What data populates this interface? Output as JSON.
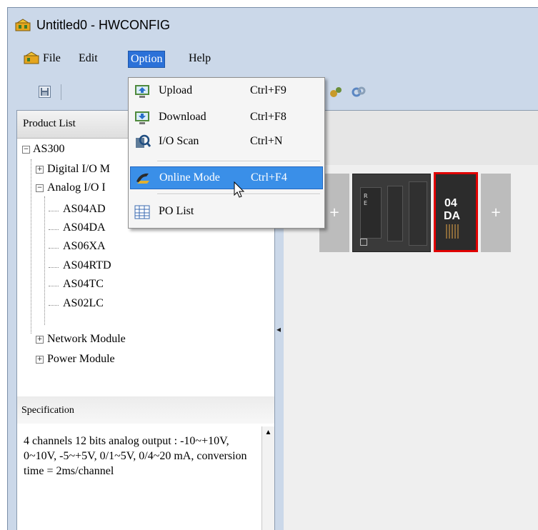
{
  "window": {
    "title": "Untitled0 - HWCONFIG"
  },
  "menubar": {
    "items": [
      {
        "label": "File",
        "accel": "F"
      },
      {
        "label": "Edit",
        "accel": ""
      },
      {
        "label": "Option",
        "accel": "O"
      },
      {
        "label": "Help",
        "accel": "H"
      }
    ]
  },
  "option_menu": {
    "items": [
      {
        "label": "Upload",
        "shortcut": "Ctrl+F9",
        "icon": "upload-icon"
      },
      {
        "label": "Download",
        "shortcut": "Ctrl+F8",
        "icon": "download-icon"
      },
      {
        "label": "I/O Scan",
        "shortcut": "Ctrl+N",
        "icon": "io-scan-icon"
      },
      {
        "label": "Online Mode",
        "shortcut": "Ctrl+F4",
        "icon": "online-mode-icon",
        "highlighted": true
      },
      {
        "label": "PO List",
        "shortcut": "",
        "icon": "po-list-icon"
      }
    ]
  },
  "product_list": {
    "title": "Product List",
    "tree": {
      "root": "AS300",
      "digital": "Digital I/O M",
      "analog": "Analog I/O I",
      "analog_children": [
        "AS04AD",
        "AS04DA",
        "AS06XA",
        "AS04RTD",
        "AS04TC",
        "AS02LC"
      ],
      "network": "Network Module",
      "power": "Power Module"
    }
  },
  "specification": {
    "title": "Specification",
    "text": "4 channels 12 bits analog output : -10~+10V, 0~10V, -5~+5V, 0/1~5V, 0/4~20 mA, conversion time = 2ms/channel"
  },
  "canvas": {
    "plus_label": "+",
    "module_top": "04",
    "module_bottom": "DA",
    "cpu_tag": "R\nE"
  },
  "colors": {
    "menu_highlight": "#2b71d8",
    "selected_border": "#e00000",
    "hover_item": "#3a8fe8"
  }
}
